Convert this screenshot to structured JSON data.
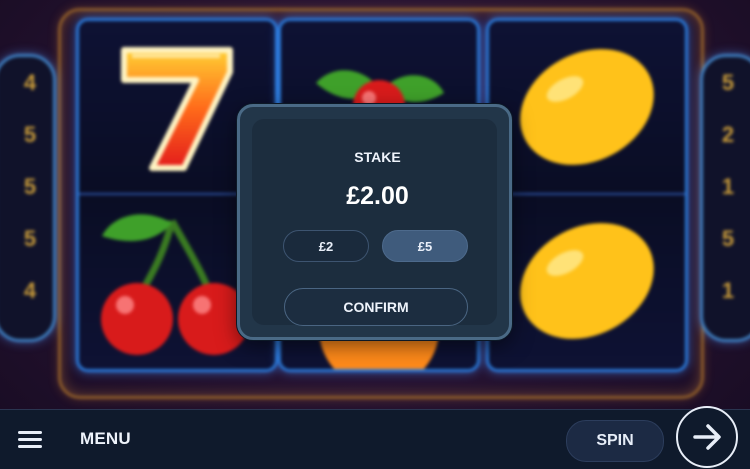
{
  "left_counters": [
    "4",
    "5",
    "5",
    "5",
    "4"
  ],
  "right_counters": [
    "5",
    "2",
    "1",
    "5",
    "1"
  ],
  "reels": [
    {
      "top": "seven-symbol",
      "bottom": "cherry-symbol"
    },
    {
      "top": "cherry-symbol",
      "bottom": "orange-symbol"
    },
    {
      "top": "lemon-symbol",
      "bottom": "lemon-symbol"
    }
  ],
  "stake_dialog": {
    "title": "STAKE",
    "amount": "£2.00",
    "options": [
      "£2",
      "£5"
    ],
    "selected_option": "£5",
    "confirm_label": "CONFIRM"
  },
  "bottom_bar": {
    "menu_label": "MENU",
    "spin_label": "SPIN",
    "go_icon": "arrow-right-icon",
    "menu_icon": "hamburger-menu-icon"
  },
  "colors": {
    "accent_blue": "#2b78d6",
    "frame_gold": "#8a5a2a",
    "dialog_bg": "#223649",
    "selected_pill": "#3f5b7c"
  }
}
